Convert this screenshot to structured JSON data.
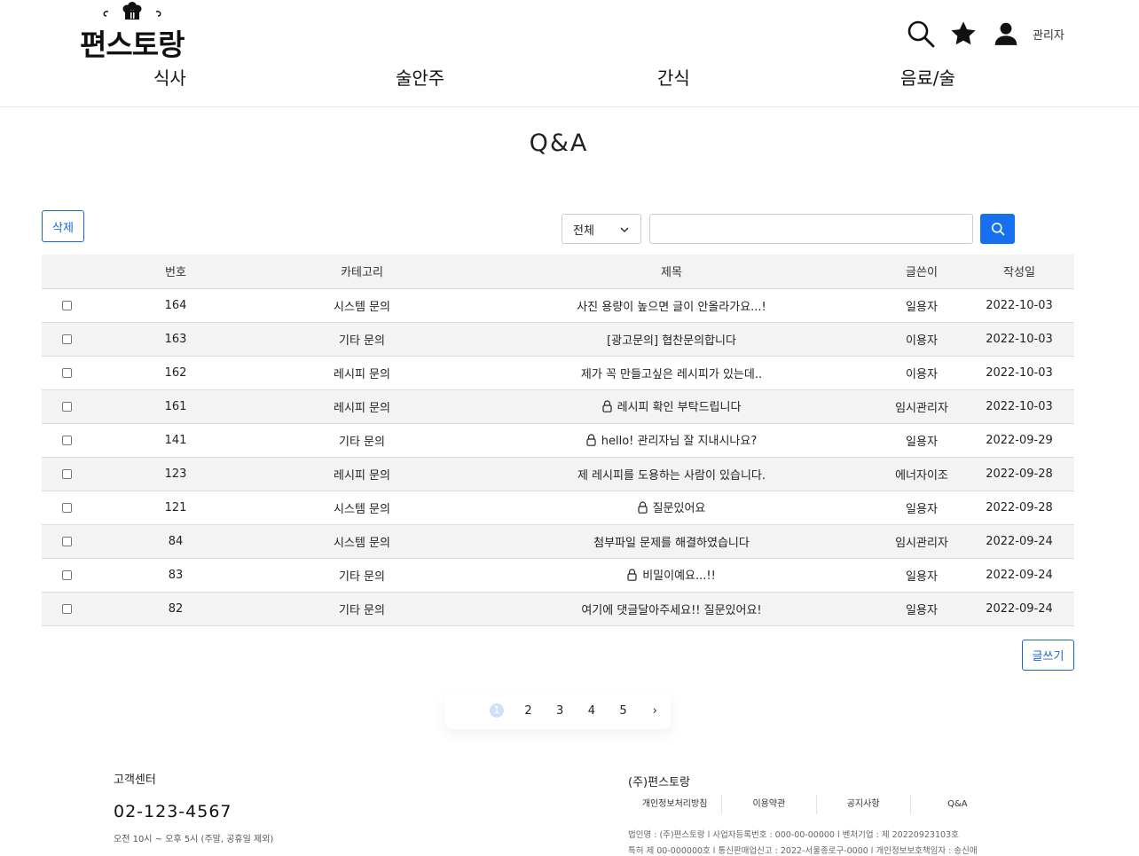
{
  "header": {
    "logo_text": "편스토랑",
    "admin_label": "관리자",
    "nav": [
      "식사",
      "술안주",
      "간식",
      "음료/술"
    ]
  },
  "page": {
    "title": "Q&A"
  },
  "toolbar": {
    "delete_label": "삭제",
    "filter_value": "전체",
    "search_placeholder": "",
    "write_label": "글쓰기"
  },
  "table": {
    "headers": [
      "번호",
      "카테고리",
      "제목",
      "글쓴이",
      "작성일"
    ],
    "rows": [
      {
        "no": "164",
        "category": "시스템 문의",
        "title": "사진 용량이 높으면 글이 안올라가요...!",
        "writer": "일용자",
        "date": "2022-10-03",
        "locked": false
      },
      {
        "no": "163",
        "category": "기타 문의",
        "title": "[광고문의] 협찬문의합니다",
        "writer": "이용자",
        "date": "2022-10-03",
        "locked": false
      },
      {
        "no": "162",
        "category": "레시피 문의",
        "title": "제가 꼭 만들고싶은 레시피가 있는데..",
        "writer": "이용자",
        "date": "2022-10-03",
        "locked": false
      },
      {
        "no": "161",
        "category": "레시피 문의",
        "title": "레시피 확인 부탁드립니다",
        "writer": "임시관리자",
        "date": "2022-10-03",
        "locked": true
      },
      {
        "no": "141",
        "category": "기타 문의",
        "title": "hello! 관리자님 잘 지내시나요?",
        "writer": "일용자",
        "date": "2022-09-29",
        "locked": true
      },
      {
        "no": "123",
        "category": "레시피 문의",
        "title": "제 레시피를 도용하는 사람이 있습니다.",
        "writer": "에너자이조",
        "date": "2022-09-28",
        "locked": false
      },
      {
        "no": "121",
        "category": "시스템 문의",
        "title": "질문있어요",
        "writer": "일용자",
        "date": "2022-09-28",
        "locked": true
      },
      {
        "no": "84",
        "category": "시스템 문의",
        "title": "첨부파일 문제를 해결하였습니다",
        "writer": "임시관리자",
        "date": "2022-09-24",
        "locked": false
      },
      {
        "no": "83",
        "category": "기타 문의",
        "title": "비밀이예요...!!",
        "writer": "일용자",
        "date": "2022-09-24",
        "locked": true
      },
      {
        "no": "82",
        "category": "기타 문의",
        "title": "여기에 댓글달아주세요!! 질문있어요!",
        "writer": "일용자",
        "date": "2022-09-24",
        "locked": false
      }
    ]
  },
  "pagination": {
    "current": "1",
    "pages": [
      "2",
      "3",
      "4",
      "5"
    ],
    "next": "›"
  },
  "footer": {
    "cs_title": "고객센터",
    "phone": "02-123-4567",
    "hours": "오전 10시 ~ 오후 5시 (주말, 공휴일 제외)",
    "company": "(주)편스토랑",
    "links": [
      "개인정보처리방침",
      "이용약관",
      "공지사항",
      "Q&A"
    ],
    "info_line1": "법인명 : (주)편스토랑 l 사업자등록번호 : 000-00-00000 l 벤처기업 : 제 20220923103호",
    "info_line2": "특허 제 00-000000호 l 통신판매업신고 : 2022-서울종로구-0000 l 개인정보보호책임자 : 송신애"
  },
  "colors": {
    "accent": "#1670f0",
    "outline": "#1a67d2",
    "row_alt": "#f3f3f3"
  }
}
